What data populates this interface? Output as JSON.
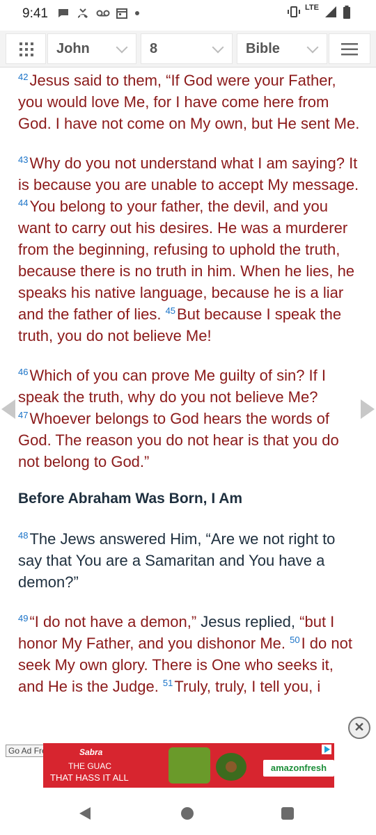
{
  "status_bar": {
    "time": "9:41",
    "network": "LTE",
    "icons_left": [
      "message-icon",
      "missed-call-icon",
      "voicemail-icon",
      "calendar-icon",
      "dot-icon"
    ],
    "icons_right": [
      "vibrate-icon",
      "signal-icon",
      "battery-icon"
    ]
  },
  "nav": {
    "book": "John",
    "chapter": "8",
    "version": "Bible"
  },
  "passages": [
    {
      "segments": [
        {
          "verse": "42",
          "text": "Jesus said to them, “If God were your Father, you would love Me, for I have come here from God. I have not come on My own, but He sent Me."
        }
      ]
    },
    {
      "segments": [
        {
          "verse": "43",
          "text": "Why do you not understand what I am saying? It is because you are unable to accept My message. "
        },
        {
          "verse": "44",
          "text": "You belong to your father, the devil, and you want to carry out his desires. He was a murderer from the beginning, refusing to uphold the truth, because there is no truth in him. When he lies, he speaks his native language, because he is a liar and the father of lies. "
        },
        {
          "verse": "45",
          "text": "But because I speak the truth, you do not believe Me!"
        }
      ]
    },
    {
      "segments": [
        {
          "verse": "46",
          "text": "Which of you can prove Me guilty of sin? If I speak the truth, why do you not believe Me? "
        },
        {
          "verse": "47",
          "text": "Whoever belongs to God hears the words of God. The reason you do not hear is that you do not belong to God.”"
        }
      ]
    }
  ],
  "section_heading": "Before Abraham Was Born, I Am",
  "verse48": {
    "verse": "48",
    "text": "The Jews answered Him, “Are we not right to say that You are a Samaritan and You have a demon?”"
  },
  "verse49": {
    "v49": "49",
    "t49a": "“I do not have a demon,”",
    "t49b": " Jesus replied, ",
    "t49c": "“but I honor My Father, and you dishonor Me. ",
    "v50": "50",
    "t50": "I do not seek My own glory. There is One who seeks it, and He is the Judge. ",
    "v51": "51",
    "t51": "Truly, truly, I tell you, i"
  },
  "ad": {
    "go_ad_free": "Go Ad Free",
    "brand": "Sabra",
    "line1": "THE GUAC",
    "line2": "THAT HASS IT ALL",
    "partner": "amazonfresh",
    "close": "✕"
  }
}
